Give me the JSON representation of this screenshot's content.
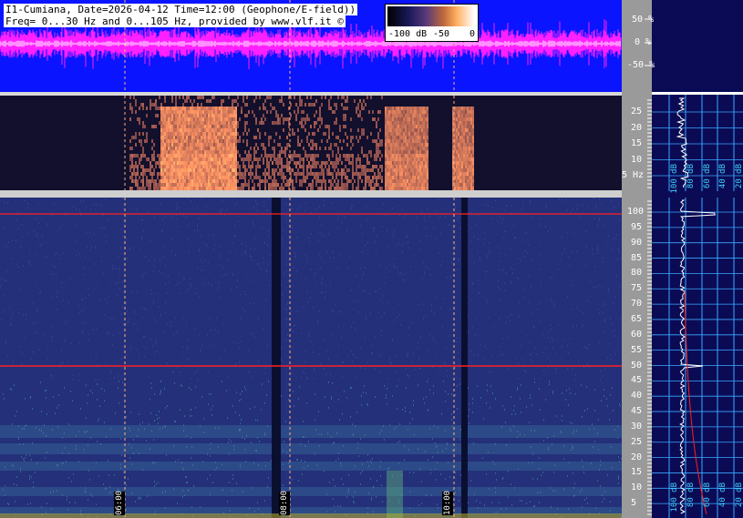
{
  "header": {
    "title_line1": "I1-Cumiana, Date=2026-04-12 Time=12:00 (Geophone/E-field))",
    "title_line2": "Freq= 0...30 Hz and 0...105 Hz, provided by www.vlf.it ©"
  },
  "colorbar": {
    "labels": [
      "-100 dB",
      "-50",
      "0"
    ]
  },
  "waveform_axis": [
    "50 %",
    "0 %",
    "-50 %"
  ],
  "low_axis": [
    "25",
    "20",
    "15",
    "10",
    "5 Hz"
  ],
  "high_axis": [
    "100",
    "95",
    "90",
    "85",
    "80",
    "75",
    "70",
    "65",
    "60",
    "55",
    "50",
    "45",
    "40",
    "45",
    "30",
    "25",
    "20",
    "15",
    "10",
    "5"
  ],
  "time_labels": [
    "06:00",
    "08:00",
    "10:00"
  ],
  "side_db_low": [
    "100 dB",
    "80 dB",
    "60 dB",
    "40 dB",
    "20 dB"
  ],
  "side_db_high": [
    "100 dB",
    "80 dB",
    "60 dB",
    "40 dB",
    "20 dB"
  ],
  "colors": {
    "waveform_bg": "#0a14ff",
    "waveform_trace": "#ff20ff",
    "spectrogram_low_bg": "#12102c",
    "spectrogram_high_bg": "#24307a",
    "grid_line": "#ffb080",
    "red_line": "#ff2020",
    "side_bg": "#0b0b55",
    "side_grid": "#3aa8ff"
  }
}
